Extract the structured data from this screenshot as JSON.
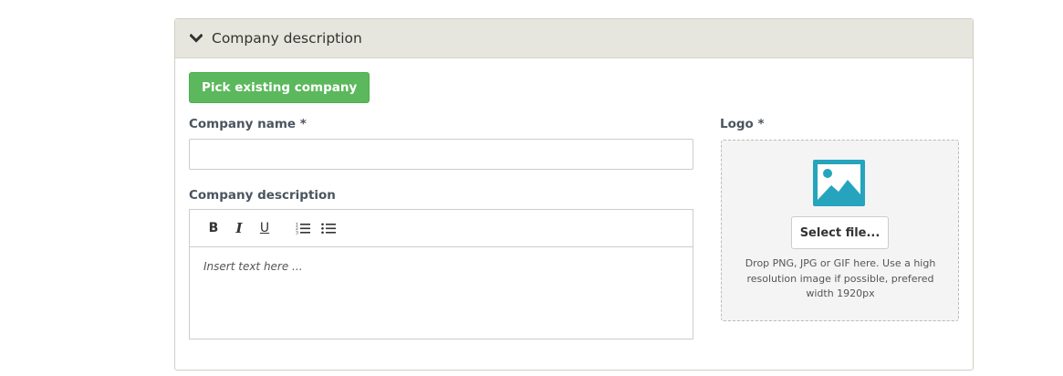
{
  "panel": {
    "title": "Company description",
    "chevron_icon": "chevron-down-icon"
  },
  "pick_company_button": "Pick existing company",
  "company_name": {
    "label": "Company name *",
    "value": ""
  },
  "company_description": {
    "label": "Company description",
    "toolbar": {
      "bold": "B",
      "italic": "I",
      "underline": "U",
      "ordered_list_icon": "ordered-list-icon",
      "bullet_list_icon": "bullet-list-icon"
    },
    "placeholder": "Insert text here ..."
  },
  "logo": {
    "label": "Logo *",
    "image_icon": "image-placeholder-icon",
    "select_button": "Select file...",
    "hint": "Drop PNG, JPG or GIF here. Use a high resolution image if possible, prefered width 1920px"
  },
  "colors": {
    "header_bg": "#e6e6de",
    "success_green": "#5cb85c",
    "icon_teal": "#26a4bd"
  }
}
